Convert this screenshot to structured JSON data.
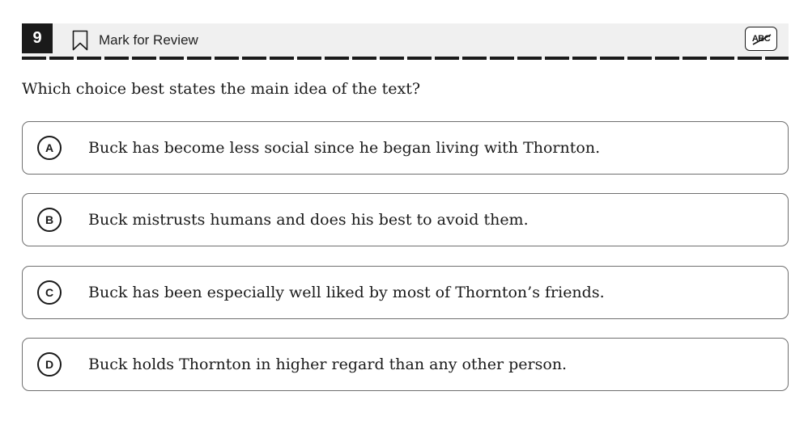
{
  "header": {
    "question_number": "9",
    "mark_for_review_label": "Mark for Review",
    "mark_for_review_icon": "bookmark-icon",
    "eliminator_label": "ABC",
    "eliminator_icon": "answer-eliminator-icon"
  },
  "question": {
    "prompt": "Which choice best states the main idea of the text?"
  },
  "options": [
    {
      "letter": "A",
      "text": "Buck has become less social since he began living with Thornton."
    },
    {
      "letter": "B",
      "text": "Buck mistrusts humans and does his best to avoid them."
    },
    {
      "letter": "C",
      "text": "Buck has been especially well liked by most of Thornton’s friends."
    },
    {
      "letter": "D",
      "text": "Buck holds Thornton in higher regard than any other person."
    }
  ],
  "colors": {
    "header_bg": "#f0f0f0",
    "question_number_bg": "#1a1a1a",
    "option_border": "#6f6f6f",
    "text": "#1a1a1a"
  }
}
